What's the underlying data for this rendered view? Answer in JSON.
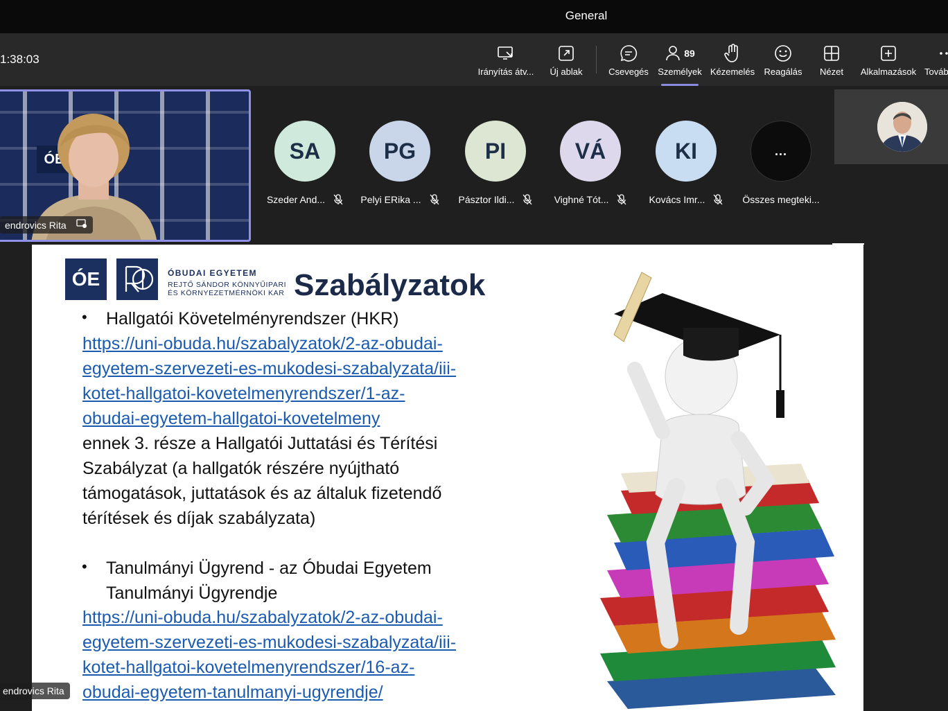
{
  "window": {
    "title": "General"
  },
  "toolbar": {
    "timer": "1:38:03",
    "buttons": [
      {
        "label": "Irányítás átv...",
        "icon": "share-control-icon"
      },
      {
        "label": "Új ablak",
        "icon": "new-window-icon"
      },
      {
        "label": "Csevegés",
        "icon": "chat-icon"
      },
      {
        "label": "Személyek",
        "icon": "people-icon",
        "count": "89",
        "active": true
      },
      {
        "label": "Kézemelés",
        "icon": "raise-hand-icon"
      },
      {
        "label": "Reagálás",
        "icon": "emoji-icon"
      },
      {
        "label": "Nézet",
        "icon": "view-grid-icon"
      },
      {
        "label": "Alkalmazások",
        "icon": "add-apps-icon"
      },
      {
        "label": "Továb",
        "icon": "more-icon"
      }
    ],
    "accent": "#8a8ce0"
  },
  "speaker": {
    "name": "endrovics Rita",
    "logo": "ÓE"
  },
  "participants": [
    {
      "initials": "SA",
      "name": "Szeder And...",
      "color": "#cfe9dc"
    },
    {
      "initials": "PG",
      "name": "Pelyi ERika ...",
      "color": "#c9d6ea"
    },
    {
      "initials": "PI",
      "name": "Pásztor Ildi...",
      "color": "#dde6d3"
    },
    {
      "initials": "VÁ",
      "name": "Vighné Tót...",
      "color": "#ddd8ec"
    },
    {
      "initials": "KI",
      "name": "Kovács Imr...",
      "color": "#c9ddf2"
    }
  ],
  "more_participants": {
    "label": "Összes megteki...",
    "icon": "..."
  },
  "presenter_tag": "endrovics Rita",
  "slide": {
    "logo_text": "ÓE",
    "university": "ÓBUDAI EGYETEM",
    "faculty_line1": "REJTŐ SÁNDOR KÖNNYŰIPARI",
    "faculty_line2": "ÉS KÖRNYEZETMÉRNÖKI KAR",
    "title": "Szabályzatok",
    "bullet1": "Hallgatói Követelményrendszer (HKR)",
    "link1": [
      "https://uni-obuda.hu/szabalyzatok/2-az-obudai-",
      "egyetem-szervezeti-es-mukodesi-szabalyzata/iii-",
      "kotet-hallgatoi-kovetelmenyrendszer/1-az-",
      "obudai-egyetem-hallgatoi-kovetelmeny"
    ],
    "para1": [
      " ennek 3. része a Hallgatói Juttatási és Térítési",
      "Szabályzat (a hallgatók részére nyújtható",
      "támogatások, juttatások és az általuk fizetendő",
      "térítések és díjak szabályzata)"
    ],
    "bullet2_line1": "Tanulmányi Ügyrend  - az Óbudai Egyetem",
    "bullet2_line2": "Tanulmányi Ügyrendje",
    "link2": [
      "https://uni-obuda.hu/szabalyzatok/2-az-obudai-",
      "egyetem-szervezeti-es-mukodesi-szabalyzata/iii-",
      "kotet-hallgatoi-kovetelmenyrendszer/16-az-",
      "obudai-egyetem-tanulmanyi-ugyrendje/"
    ]
  }
}
